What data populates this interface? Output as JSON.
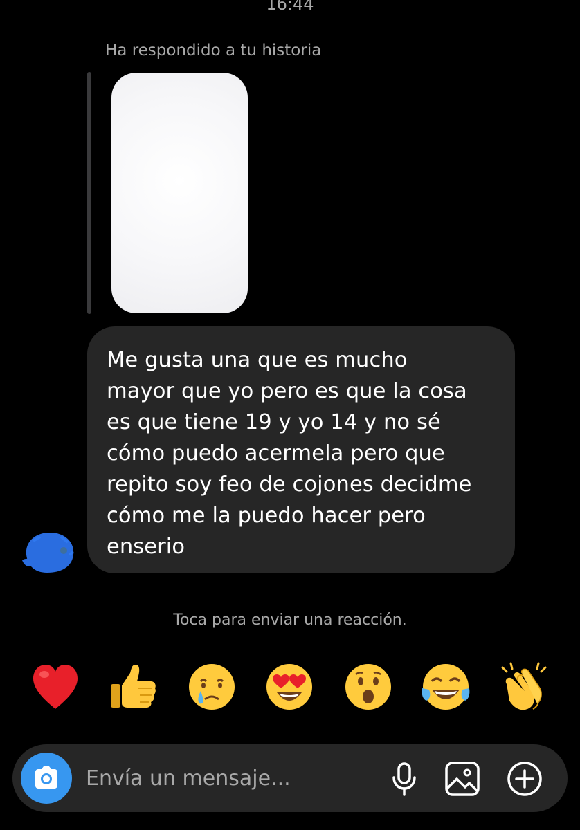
{
  "header": {
    "timestamp": "16:44"
  },
  "story_reply": {
    "label": "Ha respondido a tu historia"
  },
  "message": {
    "text": "Me gusta una que es mucho\nmayor que yo pero es que la cosa\nes que tiene 19 y yo 14 y no sé\ncómo puedo acermela pero que\nrepito soy feo de cojones decidme\ncómo me la puedo hacer pero\nenserio"
  },
  "reaction_hint": "Toca para enviar una reacción.",
  "reactions": [
    {
      "icon": "red-heart-icon"
    },
    {
      "icon": "thumbs-up-icon"
    },
    {
      "icon": "crying-face-icon"
    },
    {
      "icon": "heart-eyes-face-icon"
    },
    {
      "icon": "surprised-face-icon"
    },
    {
      "icon": "tears-of-joy-face-icon"
    },
    {
      "icon": "clapping-hands-icon"
    }
  ],
  "composer": {
    "placeholder": "Envía un mensaje..."
  },
  "colors": {
    "background": "#000000",
    "bubble": "#262626",
    "accent": "#3797f0",
    "secondary_text": "#a8a8a8"
  }
}
